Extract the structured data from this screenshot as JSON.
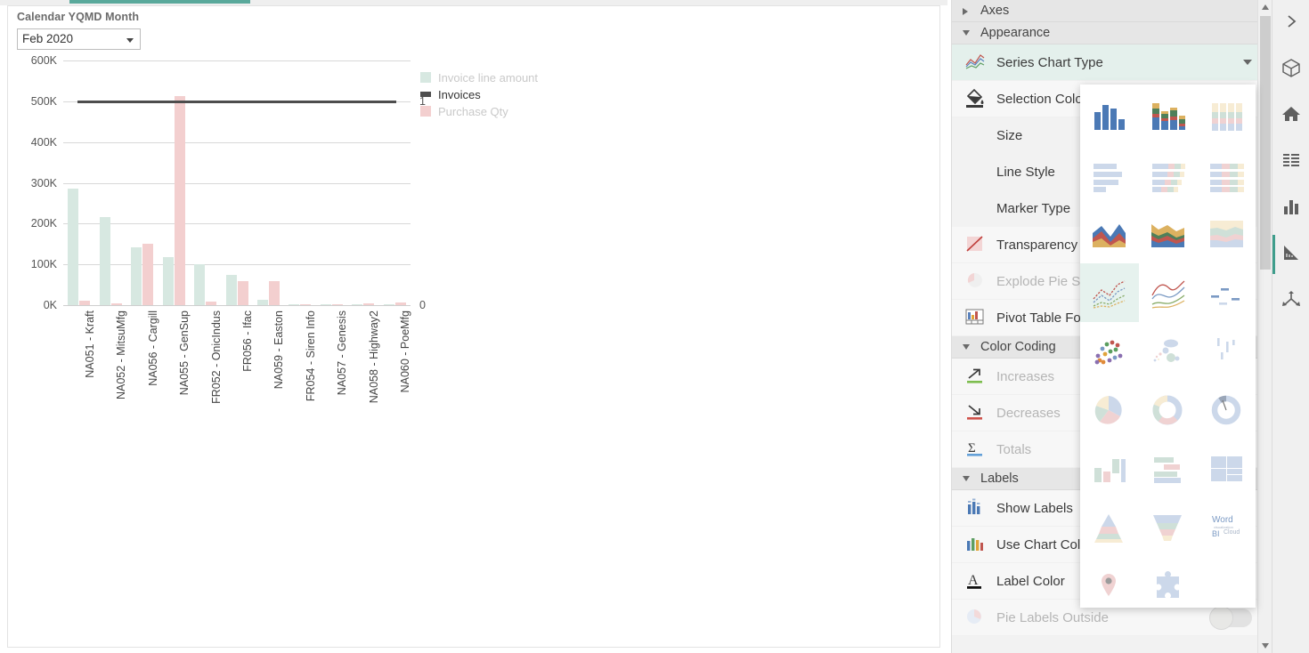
{
  "filter": {
    "label": "Calendar YQMD Month",
    "value": "Feb 2020",
    "caret_icon": "chevron-down-icon"
  },
  "chart_data": {
    "type": "bar",
    "title": "",
    "xlabel": "",
    "ylabel": "",
    "ylim": [
      0,
      600000
    ],
    "ytick_labels": [
      "0K",
      "100K",
      "200K",
      "300K",
      "400K",
      "500K",
      "600K"
    ],
    "ytick_values": [
      0,
      100000,
      200000,
      300000,
      400000,
      500000,
      600000
    ],
    "secondary_axis": {
      "ticks": [
        "0",
        "1"
      ],
      "values": [
        0,
        1
      ],
      "ylim": [
        0,
        1
      ]
    },
    "grid": true,
    "legend_position": "right",
    "categories": [
      "NA051 - Kraft",
      "NA052 - MitsuMfg",
      "NA056 - Cargill",
      "NA055 - GenSup",
      "FR052 - OnicIndus",
      "FR056 - Ifac",
      "NA059 - Easton",
      "FR054 - Siren Info",
      "NA057 - Genesis",
      "NA058 - Highway2",
      "NA060 - PoeMfg"
    ],
    "series": [
      {
        "name": "Invoice line amount",
        "color": "#d7e8e1",
        "type": "bar",
        "axis": "left",
        "values": [
          286000,
          217000,
          142000,
          117000,
          101000,
          74000,
          14000,
          3000,
          1500,
          1000,
          800
        ]
      },
      {
        "name": "Invoices",
        "color": "#4d4d4d",
        "type": "line",
        "axis": "right",
        "values": [
          1,
          1,
          1,
          1,
          1,
          1,
          1,
          1,
          1,
          1,
          1
        ]
      },
      {
        "name": "Purchase Qty",
        "color": "#f3cfcf",
        "type": "bar",
        "axis": "left",
        "values": [
          11000,
          4000,
          151000,
          513000,
          9000,
          60000,
          60000,
          500,
          2500,
          3500,
          6000
        ]
      }
    ]
  },
  "legend": {
    "items": [
      {
        "label": "Invoice line amount",
        "color": "#d7e8e1",
        "text_color": "#c9c9c9",
        "shape": "square"
      },
      {
        "label": "Invoices",
        "color": "#4d4d4d",
        "text_color": "#333333",
        "shape": "line"
      },
      {
        "label": "Purchase Qty",
        "color": "#f3cfcf",
        "text_color": "#c9c9c9",
        "shape": "square"
      }
    ]
  },
  "settings_panel": {
    "sections": [
      {
        "title": "Axes",
        "state": "collapsed",
        "caret_icon": "triangle-right-icon",
        "items": []
      },
      {
        "title": "Appearance",
        "state": "expanded",
        "caret_icon": "triangle-down-icon",
        "items": [
          {
            "label": "Series Chart Type",
            "icon": "line-chart-icon",
            "selected": true,
            "has_dropdown": true,
            "disabled": false
          },
          {
            "label": "Selection Color",
            "icon": "paint-bucket-icon",
            "selected": false,
            "has_dropdown": false,
            "disabled": false
          },
          {
            "label": "Size",
            "icon": "none",
            "selected": false,
            "has_dropdown": false,
            "disabled": false
          },
          {
            "label": "Line Style",
            "icon": "none",
            "selected": false,
            "has_dropdown": false,
            "disabled": false
          },
          {
            "label": "Marker Type",
            "icon": "none",
            "selected": false,
            "has_dropdown": false,
            "disabled": false
          },
          {
            "label": "Transparency",
            "icon": "transparency-icon",
            "selected": false,
            "has_dropdown": false,
            "disabled": false
          },
          {
            "label": "Explode Pie Se",
            "icon": "explode-pie-icon",
            "selected": false,
            "has_dropdown": false,
            "disabled": true
          },
          {
            "label": "Pivot Table For",
            "icon": "pivot-table-icon",
            "selected": false,
            "has_dropdown": false,
            "disabled": false
          }
        ]
      },
      {
        "title": "Color Coding",
        "state": "expanded",
        "caret_icon": "triangle-down-icon",
        "items": [
          {
            "label": "Increases",
            "icon": "arrow-up-right-icon",
            "selected": false,
            "has_dropdown": false,
            "disabled": true
          },
          {
            "label": "Decreases",
            "icon": "arrow-down-right-icon",
            "selected": false,
            "has_dropdown": false,
            "disabled": true
          },
          {
            "label": "Totals",
            "icon": "sigma-icon",
            "selected": false,
            "has_dropdown": false,
            "disabled": true
          }
        ]
      },
      {
        "title": "Labels",
        "state": "expanded",
        "caret_icon": "triangle-down-icon",
        "items": [
          {
            "label": "Show Labels",
            "icon": "bar-labels-icon",
            "selected": false,
            "has_dropdown": false,
            "disabled": false
          },
          {
            "label": "Use Chart Colo",
            "icon": "chart-colors-icon",
            "selected": false,
            "has_dropdown": false,
            "disabled": false
          },
          {
            "label": "Label Color",
            "icon": "font-color-icon",
            "selected": false,
            "has_dropdown": false,
            "disabled": false
          },
          {
            "label": "Pie Labels Outside",
            "icon": "pie-labels-icon",
            "selected": false,
            "has_dropdown": false,
            "disabled": true,
            "toggle": "off"
          }
        ]
      }
    ],
    "scrollbar": {
      "up_arrow_icon": "triangle-up-icon",
      "down_arrow_icon": "triangle-down-icon"
    }
  },
  "chart_type_flyout": {
    "selected_index": 9,
    "options": [
      {
        "name": "column-chart",
        "icon": "column-chart-icon"
      },
      {
        "name": "stacked-column-chart",
        "icon": "stacked-column-chart-icon"
      },
      {
        "name": "100-percent-stacked-column-chart",
        "icon": "pct-stacked-column-icon"
      },
      {
        "name": "bar-chart",
        "icon": "bar-chart-icon"
      },
      {
        "name": "stacked-bar-chart",
        "icon": "stacked-bar-chart-icon"
      },
      {
        "name": "100-percent-stacked-bar-chart",
        "icon": "pct-stacked-bar-icon"
      },
      {
        "name": "area-chart",
        "icon": "area-chart-icon"
      },
      {
        "name": "stacked-area-chart",
        "icon": "stacked-area-chart-icon"
      },
      {
        "name": "100-percent-stacked-area-chart",
        "icon": "pct-stacked-area-icon"
      },
      {
        "name": "line-chart",
        "icon": "line-chart-icon"
      },
      {
        "name": "smooth-line-chart",
        "icon": "smooth-line-chart-icon"
      },
      {
        "name": "step-line-chart",
        "icon": "step-line-chart-icon"
      },
      {
        "name": "scatter-chart",
        "icon": "scatter-chart-icon"
      },
      {
        "name": "bubble-chart",
        "icon": "bubble-chart-icon"
      },
      {
        "name": "box-plot",
        "icon": "box-plot-icon"
      },
      {
        "name": "pie-chart",
        "icon": "pie-chart-icon"
      },
      {
        "name": "donut-chart",
        "icon": "donut-chart-icon"
      },
      {
        "name": "gauge-chart",
        "icon": "gauge-chart-icon"
      },
      {
        "name": "waterfall-chart",
        "icon": "waterfall-chart-icon"
      },
      {
        "name": "tornado-chart",
        "icon": "tornado-chart-icon"
      },
      {
        "name": "treemap-chart",
        "icon": "treemap-chart-icon"
      },
      {
        "name": "pyramid-chart",
        "icon": "pyramid-chart-icon"
      },
      {
        "name": "funnel-chart",
        "icon": "funnel-chart-icon"
      },
      {
        "name": "word-cloud",
        "icon": "word-cloud-icon",
        "text": "Word Cloud BI"
      },
      {
        "name": "map-chart",
        "icon": "map-pin-icon"
      },
      {
        "name": "custom-chart",
        "icon": "puzzle-piece-icon"
      }
    ]
  },
  "right_rail": {
    "items": [
      {
        "name": "expand-panel",
        "icon": "chevron-right-icon",
        "active": false
      },
      {
        "name": "objects",
        "icon": "cube-icon",
        "active": false
      },
      {
        "name": "home",
        "icon": "home-icon",
        "active": false
      },
      {
        "name": "data-table",
        "icon": "list-icon",
        "active": false
      },
      {
        "name": "chart",
        "icon": "bar-chart-icon",
        "active": false
      },
      {
        "name": "design",
        "icon": "ruler-triangle-icon",
        "active": true
      },
      {
        "name": "axes",
        "icon": "axes-node-icon",
        "active": false
      }
    ]
  },
  "colors": {
    "accent_teal": "#5aa99b",
    "invoice_line_amount": "#d7e8e1",
    "purchase_qty": "#f3cfcf",
    "invoices_line": "#4d4d4d",
    "panel_bg": "#f2f2f2",
    "selected_row": "#e4f0ec"
  }
}
